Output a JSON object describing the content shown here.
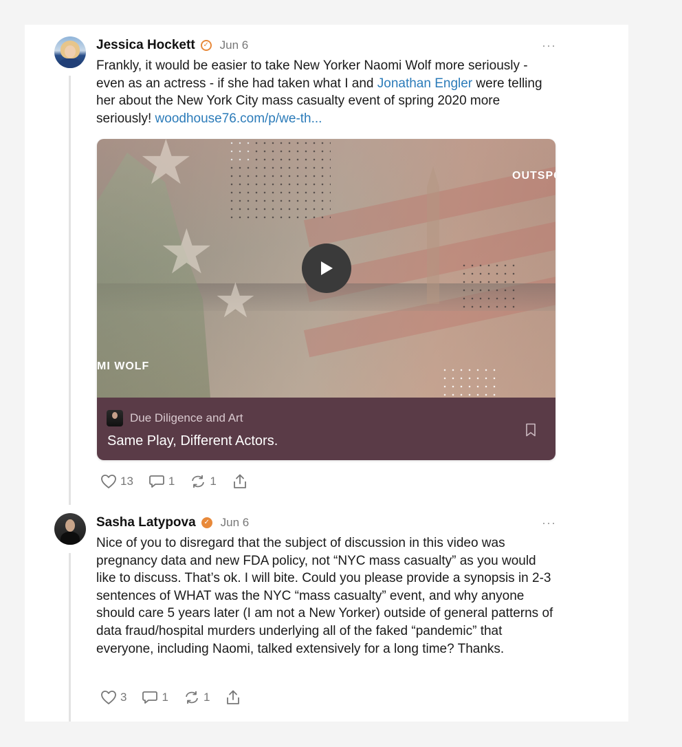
{
  "comments": [
    {
      "author": "Jessica Hockett",
      "date": "Jun 6",
      "verified": true,
      "more": "···",
      "text_part1": "Frankly, it would be easier to take New Yorker Naomi Wolf more seriously - even as an actress - if she had taken what I and ",
      "mention": "Jonathan Engler",
      "text_part2": " were telling her about the New York City mass casualty event of spring 2020 more seriously! ",
      "link": "woodhouse76.com/p/we-th...",
      "embed": {
        "overlay_right": "OUTSPO",
        "overlay_left": "MI WOLF",
        "publication": "Due Diligence and Art",
        "title": "Same Play, Different Actors."
      },
      "likes": "13",
      "comments": "1",
      "restacks": "1"
    },
    {
      "author": "Sasha Latypova",
      "date": "Jun 6",
      "verified": true,
      "more": "···",
      "text": "Nice of you to disregard that the subject of discussion in this video was pregnancy data and new FDA policy, not “NYC mass casualty” as you would like to discuss. That’s ok. I will bite. Could you please provide a synopsis in 2-3 sentences of WHAT was the NYC “mass casualty” event, and why anyone should care 5 years later (I am not a New Yorker) outside of general patterns of data fraud/hospital murders underlying all of the faked “pandemic” that everyone, including Naomi, talked extensively for a long time? Thanks.",
      "likes": "3",
      "comments": "1",
      "restacks": "1"
    }
  ],
  "icons": {
    "verified": "check-circle-icon",
    "like": "heart-icon",
    "comment": "speech-bubble-icon",
    "restack": "refresh-icon",
    "share": "share-icon",
    "bookmark": "bookmark-icon",
    "play": "play-icon"
  },
  "colors": {
    "link": "#2b7bb9",
    "verified": "#e8893a",
    "embed_footer": "#5a3b47"
  }
}
